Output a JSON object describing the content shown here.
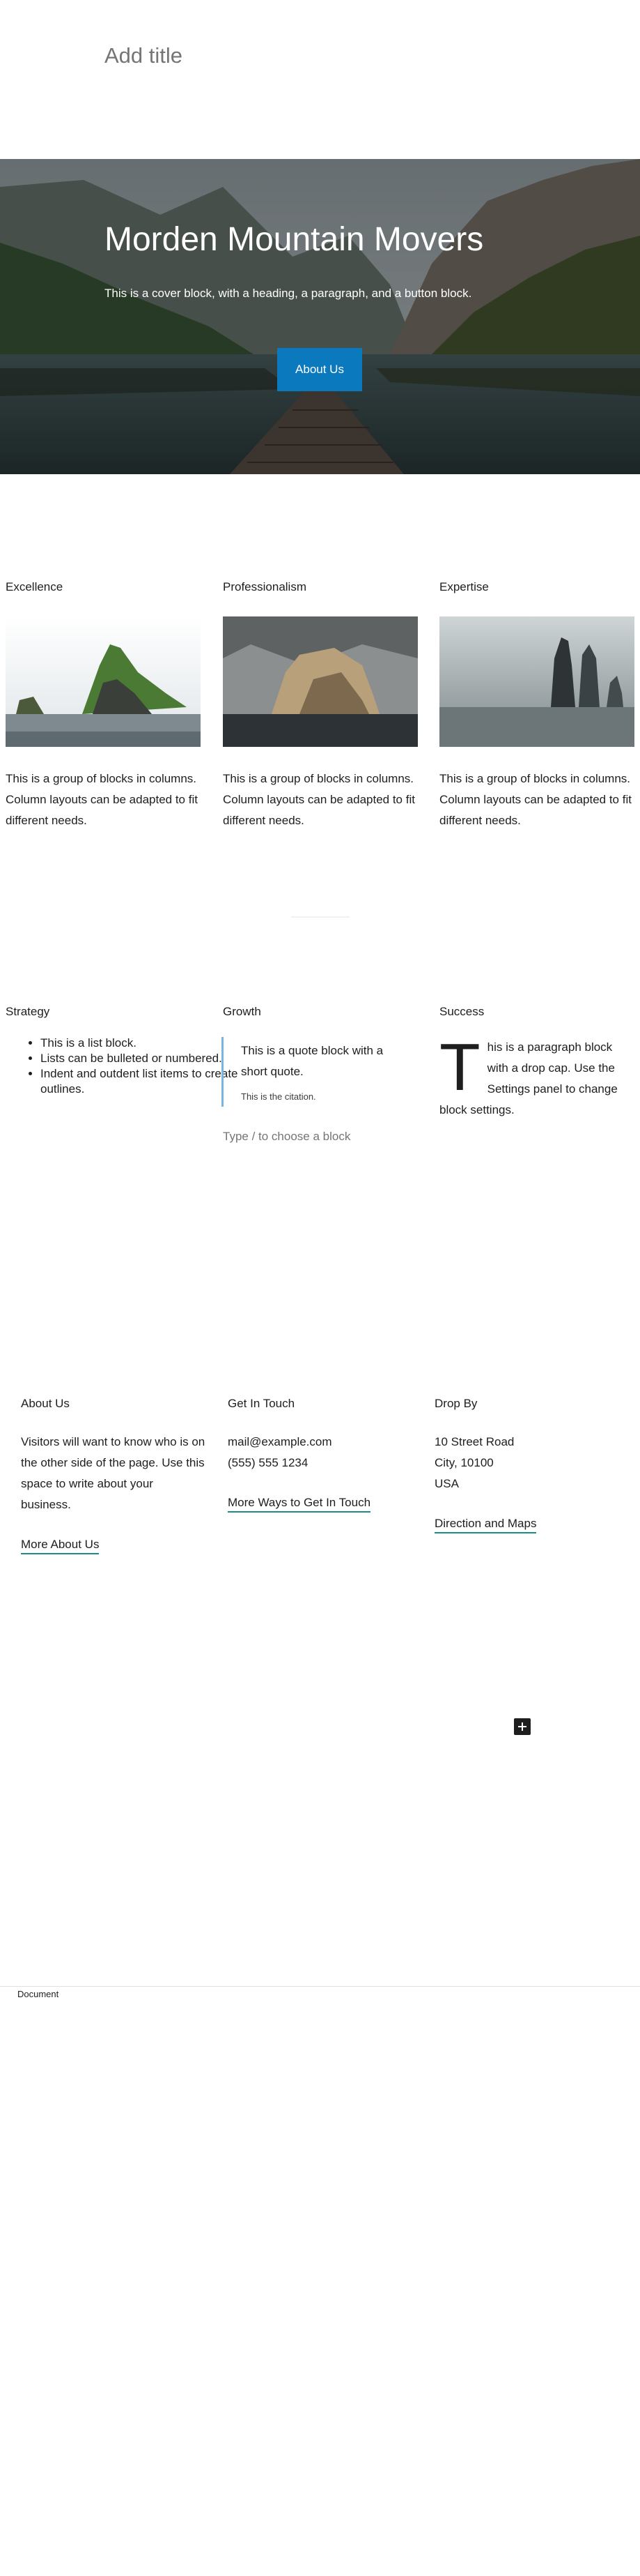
{
  "editor": {
    "title_placeholder": "Add title"
  },
  "cover": {
    "heading": "Morden Mountain Movers",
    "paragraph": "This is a cover block, with a heading, a paragraph, and a button block.",
    "button_label": "About Us"
  },
  "columns_1": [
    {
      "heading": "Excellence",
      "text": "This is a group of blocks in columns. Column layouts can be adapted to fit different needs.",
      "image": "sea-cliff-green-image"
    },
    {
      "heading": "Professionalism",
      "text": "This is a group of blocks in columns. Column layouts can be adapted to fit different needs.",
      "image": "rock-island-image"
    },
    {
      "heading": "Expertise",
      "text": "This is a group of blocks in columns. Column layouts can be adapted to fit different needs.",
      "image": "sea-stacks-image"
    }
  ],
  "columns_2": {
    "strategy": {
      "heading": "Strategy",
      "items": [
        "This is a list block.",
        "Lists can be bulleted or numbered.",
        "Indent and outdent list items to create outlines."
      ]
    },
    "growth": {
      "heading": "Growth",
      "quote": "This is a quote block with a short quote.",
      "citation": "This is the citation.",
      "appender_placeholder": "Type / to choose a block"
    },
    "success": {
      "heading": "Success",
      "dropcap_letter": "T",
      "paragraph_rest": "his is a paragraph block with a drop cap. Use the Settings panel to change block settings."
    }
  },
  "footer": {
    "about": {
      "heading": "About Us",
      "text": "Visitors will want to know who is on the other side of the page. Use this space to write about your business.",
      "link": "More About Us"
    },
    "contact": {
      "heading": "Get In Touch",
      "email": "mail@example.com",
      "phone": "(555) 555 1234",
      "link": "More Ways to Get In Touch"
    },
    "visit": {
      "heading": "Drop By",
      "address_line1": "10 Street Road",
      "address_line2": "City, 10100",
      "address_line3": "USA",
      "link": "Direction and Maps"
    }
  },
  "inserter": {
    "icon": "plus-icon"
  },
  "breadcrumb": {
    "label": "Document"
  },
  "colors": {
    "button": "#0b79bd",
    "quote_border": "#78b6dd",
    "link_underline": "#1e8a8a"
  }
}
